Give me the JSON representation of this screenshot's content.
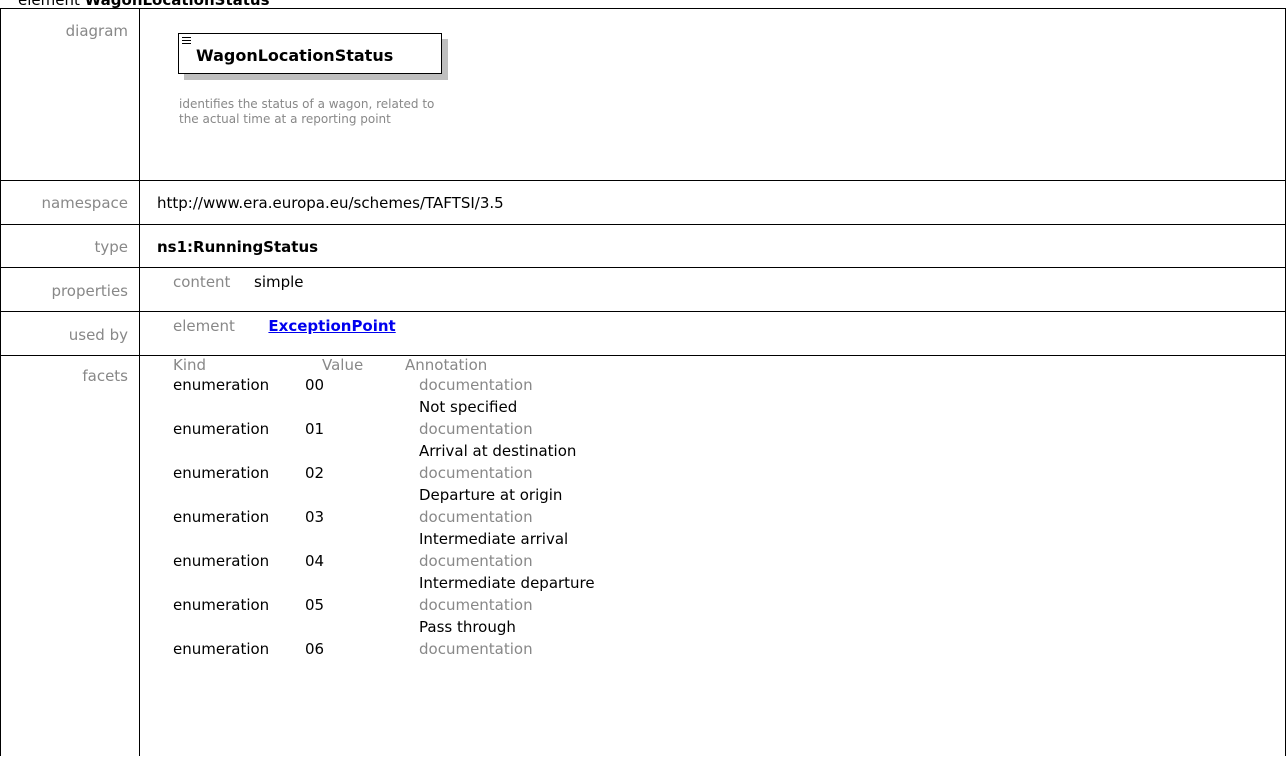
{
  "heading": {
    "prefix": "element",
    "name": "WagonLocationStatus"
  },
  "labels": {
    "diagram": "diagram",
    "namespace": "namespace",
    "type": "type",
    "properties": "properties",
    "used_by": "used by",
    "facets": "facets"
  },
  "diagram": {
    "element_name": "WagonLocationStatus",
    "documentation": "identifies the status of a wagon, related to the actual time at a reporting point"
  },
  "namespace": "http://www.era.europa.eu/schemes/TAFTSI/3.5",
  "type": "ns1:RunningStatus",
  "properties": {
    "key": "content",
    "value": "simple"
  },
  "used_by": {
    "kind": "element",
    "link": "ExceptionPoint"
  },
  "facets": {
    "headers": {
      "kind": "Kind",
      "value": "Value",
      "annotation": "Annotation"
    },
    "rows": [
      {
        "kind": "enumeration",
        "value": "00",
        "doc_label": "documentation",
        "doc_text": "Not specified"
      },
      {
        "kind": "enumeration",
        "value": "01",
        "doc_label": "documentation",
        "doc_text": "Arrival at destination"
      },
      {
        "kind": "enumeration",
        "value": "02",
        "doc_label": "documentation",
        "doc_text": "Departure at origin"
      },
      {
        "kind": "enumeration",
        "value": "03",
        "doc_label": "documentation",
        "doc_text": "Intermediate arrival"
      },
      {
        "kind": "enumeration",
        "value": "04",
        "doc_label": "documentation",
        "doc_text": "Intermediate departure"
      },
      {
        "kind": "enumeration",
        "value": "05",
        "doc_label": "documentation",
        "doc_text": "Pass through"
      },
      {
        "kind": "enumeration",
        "value": "06",
        "doc_label": "documentation",
        "doc_text": ""
      }
    ]
  }
}
